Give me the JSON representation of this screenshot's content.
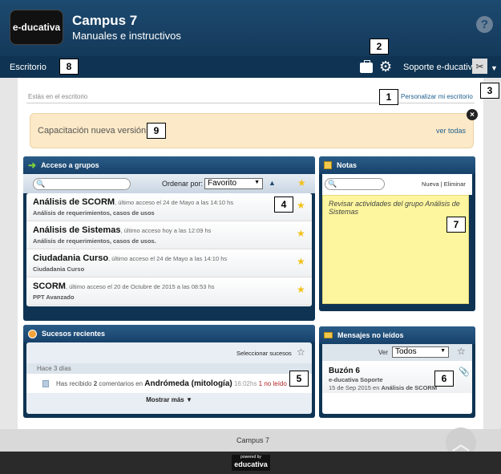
{
  "header": {
    "logo_text": "e-ducativa",
    "title": "Campus 7",
    "subtitle": "Manuales e instructivos",
    "help_glyph": "?"
  },
  "navbar": {
    "desk_label": "Escritorio",
    "user_label": "Soporte e-ducativa",
    "icons": [
      "briefcase-icon",
      "gear-icon",
      "avatar",
      "chevron-down-icon"
    ]
  },
  "breadcrumb": {
    "text": "Estás en el escritorio",
    "customize": "Personalizar mi escritorio"
  },
  "banner": {
    "text": "Capacitación nueva versión",
    "link": "ver todas",
    "close": "×"
  },
  "groups": {
    "title": "Acceso a grupos",
    "order_label": "Ordenar por:",
    "order_value": "Favorito",
    "items": [
      {
        "name": "Análisis de SCORM",
        "meta": ", último acceso el 24 de Mayo a las 14:10 hs",
        "sub": "Análisis de requerimientos, casos de usos",
        "fav": true
      },
      {
        "name": "Análisis de Sistemas",
        "meta": ", último acceso hoy a las 12:09 hs",
        "sub": "Análisis de requerimientos, casos de usos.",
        "fav": true
      },
      {
        "name": "Ciudadania Curso",
        "meta": ", último acceso el 24 de Mayo a las 14:10 hs",
        "sub": "Ciudadania Curso",
        "fav": true
      },
      {
        "name": "SCORM",
        "meta": ", último acceso el 20 de Octubre de 2015 a las 08:53 hs",
        "sub": "PPT Avanzado",
        "fav": true
      }
    ]
  },
  "notes": {
    "title": "Notas",
    "actions": "Nueva | Eliminar",
    "text": "Revisar actividades del grupo Análisis de Sistemas"
  },
  "events": {
    "title": "Sucesos recientes",
    "select_label": "Seleccionar sucesos",
    "period": "Hace 3 días",
    "item_pre": "Has recibido ",
    "item_count": "2",
    "item_mid": " comentarios en ",
    "item_target": "Andrómeda (mitología)",
    "item_time": "16:02hs",
    "item_unread": "1 no leído",
    "more": "Mostrar más"
  },
  "messages": {
    "title": "Mensajes no leídos",
    "view_label": "Ver",
    "view_value": "Todos",
    "item_title": "Buzón 6",
    "item_from": "e-ducativa Soporte",
    "item_date": "15 de Sep 2015 en ",
    "item_group": "Análisis de SCORM"
  },
  "markers": [
    "1",
    "2",
    "3",
    "4",
    "5",
    "6",
    "7",
    "8",
    "9"
  ],
  "footer": {
    "text": "Campus 7",
    "powered": "powered by",
    "brand": "educativa"
  },
  "colors": {
    "header": "#14395a",
    "navbar": "#0f3453",
    "banner": "#fce9c7",
    "note": "#fdf69e",
    "link": "#1e5f8e",
    "unread": "#b22222"
  }
}
